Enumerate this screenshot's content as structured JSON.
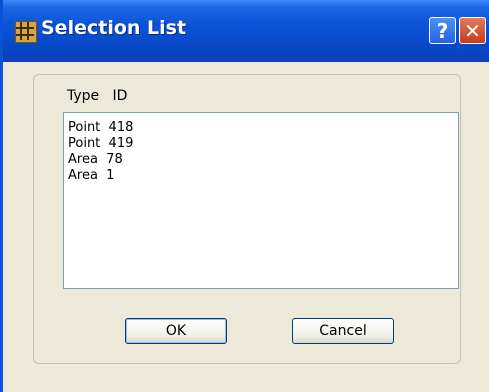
{
  "window": {
    "title": "Selection List"
  },
  "titlebar": {
    "help_label": "?",
    "close_label": "✕"
  },
  "list": {
    "header": "Type   ID",
    "items": [
      "Point  418",
      "Point  419",
      "Area  78",
      "Area  1"
    ]
  },
  "buttons": {
    "ok_label": "OK",
    "cancel_label": "Cancel"
  },
  "colors": {
    "titlebar": "#0a53d8",
    "dialog_background": "#ece9d8",
    "close_button": "#c43d1c"
  }
}
